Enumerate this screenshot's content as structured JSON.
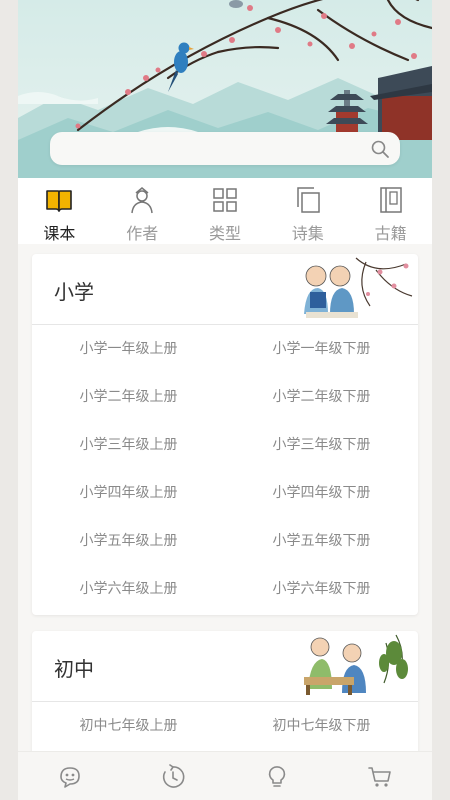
{
  "search": {
    "placeholder": ""
  },
  "tabs": [
    {
      "label": "课本",
      "icon": "book-icon",
      "active": true
    },
    {
      "label": "作者",
      "icon": "author-icon",
      "active": false
    },
    {
      "label": "类型",
      "icon": "grid-icon",
      "active": false
    },
    {
      "label": "诗集",
      "icon": "collection-icon",
      "active": false
    },
    {
      "label": "古籍",
      "icon": "classic-book-icon",
      "active": false
    }
  ],
  "sections": [
    {
      "title": "小学",
      "grades": [
        "小学一年级上册",
        "小学一年级下册",
        "小学二年级上册",
        "小学二年级下册",
        "小学三年级上册",
        "小学三年级下册",
        "小学四年级上册",
        "小学四年级下册",
        "小学五年级上册",
        "小学五年级下册",
        "小学六年级上册",
        "小学六年级下册"
      ]
    },
    {
      "title": "初中",
      "grades": [
        "初中七年级上册",
        "初中七年级下册"
      ]
    }
  ],
  "bottom_nav": [
    {
      "icon": "chat-face-icon"
    },
    {
      "icon": "history-icon"
    },
    {
      "icon": "idea-icon"
    },
    {
      "icon": "cart-icon"
    }
  ],
  "colors": {
    "accent": "#f2b300",
    "banner_sky": "#cfe6e4",
    "mountain": "#8fc3c2"
  }
}
